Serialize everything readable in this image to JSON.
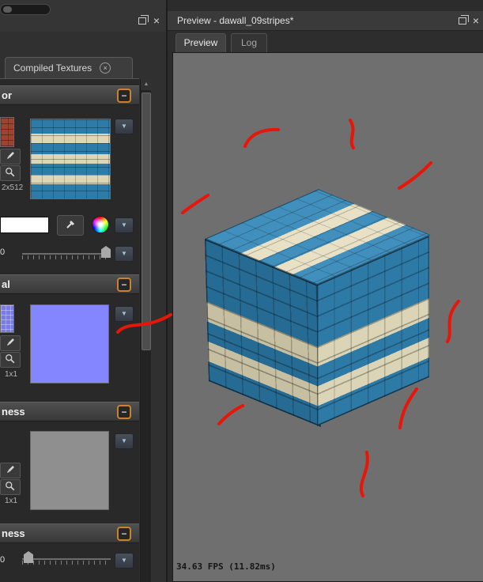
{
  "glyphs": {
    "close": "×",
    "collapse": "−",
    "dropdown": "▼",
    "scroll_up": "▲"
  },
  "left_panel": {
    "tab": {
      "label": "Compiled Textures"
    },
    "sections": {
      "color": {
        "title": "or",
        "size_label": "2x512",
        "slider_value": "0"
      },
      "normal": {
        "title": "al",
        "size_label": "1x1"
      },
      "roughness": {
        "title": "ness",
        "size_label": "1x1"
      },
      "metalness": {
        "title": "ness",
        "slider_value": "0"
      }
    }
  },
  "preview_panel": {
    "title": "Preview - dawall_09stripes*",
    "tabs": {
      "preview": "Preview",
      "log": "Log"
    },
    "fps_text": "34.63 FPS (11.82ms)"
  },
  "colors": {
    "annotation_red": "#e81508",
    "brick_blue": "#2f7ba8",
    "stripe_cream": "#ddd6b8",
    "normal_purple": "#8486ff",
    "roughness_gray": "#8f8f8f",
    "viewport_gray": "#6f6f6f",
    "collapse_border_orange": "#c8832d",
    "dropdown_arrow": "#9fc3e0"
  }
}
